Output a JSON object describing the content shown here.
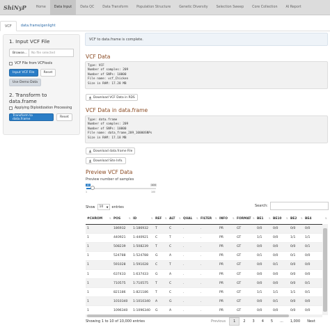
{
  "app": {
    "brand": "ShiNyP"
  },
  "nav": [
    {
      "label": "Home",
      "active": false
    },
    {
      "label": "Data Input",
      "active": true
    },
    {
      "label": "Data QC",
      "active": false
    },
    {
      "label": "Data Transform",
      "active": false
    },
    {
      "label": "Population Structure",
      "active": false
    },
    {
      "label": "Genetic Diversity",
      "active": false
    },
    {
      "label": "Selection Sweep",
      "active": false
    },
    {
      "label": "Core Collection",
      "active": false
    },
    {
      "label": "AI Report",
      "active": false
    }
  ],
  "tabs": [
    {
      "label": "VCF",
      "active": true
    },
    {
      "label": "data.frame/genlight",
      "active": false
    }
  ],
  "sidebar": {
    "input_heading": "1. Input VCF File",
    "browse_label": "Browse...",
    "file_placeholder": "No file selected",
    "vcftools_label": "VCF File from VCFtools",
    "input_button": "Input VCF File",
    "reset_button": "Reset",
    "demo_button": "Use Demo Data",
    "transform_heading": "2. Transform to data.frame",
    "diploid_label": "Applying Diploidization Processing",
    "transform_button": "Transform to data.frame",
    "reset_button_2": "Reset"
  },
  "notice": "VCF to data.frame is complete.",
  "vcf_section": {
    "heading": "VCF Data",
    "lines": [
      "Type: VCF",
      "Number of samples: 209",
      "Number of SNPs: 10000",
      "File name: vcf_Chicken",
      "Size in RAM: 17.28 MB"
    ],
    "download_button": "Download VCF Data in RDS"
  },
  "df_section": {
    "heading": "VCF Data in data.frame",
    "lines": [
      "Type: data.frame",
      "Number of samples: 209",
      "Number of SNPs: 10000",
      "File name: data_frame_209_10000SNPs",
      "Size in RAM: 17.18 MB"
    ],
    "download_df_button": "Download data.frame File",
    "download_site_button": "Download Site Info."
  },
  "preview": {
    "heading": "Preview VCF Data",
    "slider_label": "Preview number of samples",
    "slider_min": "1",
    "slider_max": "100",
    "slider_value": "10",
    "show_prefix": "Show",
    "show_value": "10",
    "show_suffix": "entries",
    "search_label": "Search:"
  },
  "table": {
    "columns": [
      "#CHROM",
      "POS",
      "ID",
      "REF",
      "ALT",
      "QUAL",
      "FILTER",
      "INFO",
      "FORMAT",
      "BE1",
      "BE10",
      "BE2",
      "BE4"
    ],
    "rows": [
      [
        "1",
        "186932",
        "1:186932",
        "T",
        "C",
        ".",
        ".",
        "PR",
        "GT",
        "0/0",
        "0/0",
        "0/0",
        "0/0"
      ],
      [
        "1",
        "440921",
        "1:440921",
        "C",
        "T",
        ".",
        ".",
        "PR",
        "GT",
        "1/1",
        "0/0",
        "1/1",
        "1/1"
      ],
      [
        "1",
        "508239",
        "1:508239",
        "T",
        "C",
        ".",
        ".",
        "PR",
        "GT",
        "0/0",
        "0/0",
        "0/0",
        "0/1"
      ],
      [
        "1",
        "524788",
        "1:524788",
        "G",
        "A",
        ".",
        ".",
        "PR",
        "GT",
        "0/1",
        "0/0",
        "0/1",
        "0/0"
      ],
      [
        "1",
        "591028",
        "1:591028",
        "C",
        "T",
        ".",
        ".",
        "PR",
        "GT",
        "0/0",
        "0/1",
        "0/0",
        "0/0"
      ],
      [
        "1",
        "637433",
        "1:637433",
        "G",
        "A",
        ".",
        ".",
        "PR",
        "GT",
        "0/0",
        "0/0",
        "0/0",
        "0/0"
      ],
      [
        "1",
        "710575",
        "1:710575",
        "T",
        "C",
        ".",
        ".",
        "PR",
        "GT",
        "0/0",
        "0/0",
        "0/0",
        "0/1"
      ],
      [
        "1",
        "821186",
        "1:821186",
        "T",
        "C",
        ".",
        ".",
        "PR",
        "GT",
        "1/1",
        "1/1",
        "1/1",
        "0/1"
      ],
      [
        "1",
        "1010340",
        "1:1010340",
        "A",
        "G",
        ".",
        ".",
        "PR",
        "GT",
        "0/0",
        "0/1",
        "0/0",
        "0/0"
      ],
      [
        "1",
        "1096340",
        "1:1096340",
        "G",
        "A",
        ".",
        ".",
        "PR",
        "GT",
        "0/0",
        "0/0",
        "0/0",
        "0/0"
      ]
    ]
  },
  "footer": {
    "info": "Showing 1 to 10 of 10,000 entries",
    "previous": "Previous",
    "pages": [
      "1",
      "2",
      "3",
      "4",
      "5",
      "...",
      "1,000"
    ],
    "next": "Next"
  },
  "colors": {
    "accent": "#2a7dc6",
    "heading": "#8a4a22",
    "navbar": "#dcdcdc"
  }
}
